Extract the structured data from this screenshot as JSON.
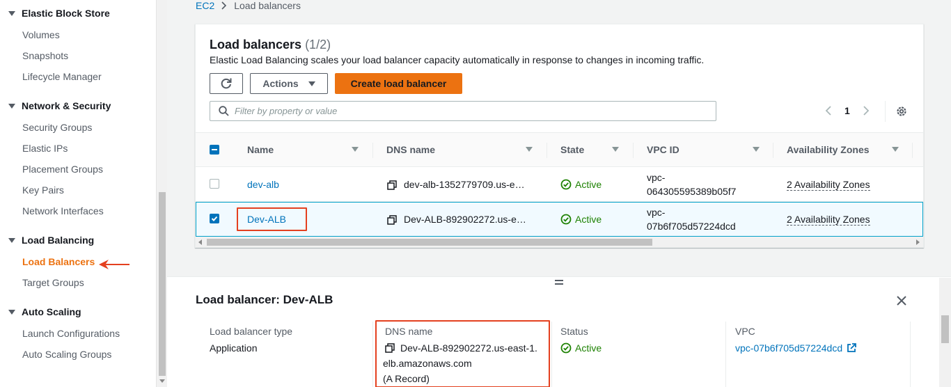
{
  "sidebar": {
    "sections": [
      {
        "label": "Elastic Block Store",
        "items": [
          "Volumes",
          "Snapshots",
          "Lifecycle Manager"
        ]
      },
      {
        "label": "Network & Security",
        "items": [
          "Security Groups",
          "Elastic IPs",
          "Placement Groups",
          "Key Pairs",
          "Network Interfaces"
        ]
      },
      {
        "label": "Load Balancing",
        "items": [
          "Load Balancers",
          "Target Groups"
        ]
      },
      {
        "label": "Auto Scaling",
        "items": [
          "Launch Configurations",
          "Auto Scaling Groups"
        ]
      }
    ],
    "active_item": "Load Balancers"
  },
  "breadcrumb": {
    "root": "EC2",
    "current": "Load balancers"
  },
  "panel": {
    "title": "Load balancers",
    "count": "(1/2)",
    "description": "Elastic Load Balancing scales your load balancer capacity automatically in response to changes in incoming traffic.",
    "actions_label": "Actions",
    "create_label": "Create load balancer",
    "filter_placeholder": "Filter by property or value",
    "page": "1"
  },
  "table": {
    "columns": [
      "Name",
      "DNS name",
      "State",
      "VPC ID",
      "Availability Zones"
    ],
    "rows": [
      {
        "name": "dev-alb",
        "dns": "dev-alb-1352779709.us-e…",
        "state": "Active",
        "vpc_line1": "vpc-",
        "vpc_line2": "064305595389b05f7",
        "az": "2 Availability Zones",
        "selected": false
      },
      {
        "name": "Dev-ALB",
        "dns": "Dev-ALB-892902272.us-e…",
        "state": "Active",
        "vpc_line1": "vpc-",
        "vpc_line2": "07b6f705d57224dcd",
        "az": "2 Availability Zones",
        "selected": true
      }
    ]
  },
  "details": {
    "title": "Load balancer: Dev-ALB",
    "type_label": "Load balancer type",
    "type_value": "Application",
    "dns_label": "DNS name",
    "dns_line1": "Dev-ALB-892902272.us-east-1.",
    "dns_line2": "elb.amazonaws.com",
    "dns_line3": "(A Record)",
    "status_label": "Status",
    "status_value": "Active",
    "vpc_label": "VPC",
    "vpc_value": "vpc-07b6f705d57224dcd"
  },
  "colors": {
    "accent": "#ec7211",
    "link": "#0073bb",
    "success": "#1d8102",
    "highlight": "#e4401f"
  },
  "icons": [
    "caret-down-icon",
    "refresh-icon",
    "search-icon",
    "settings-gear-icon",
    "copy-icon",
    "check-circle-icon",
    "close-icon",
    "external-link-icon",
    "arrow-left-icon"
  ]
}
